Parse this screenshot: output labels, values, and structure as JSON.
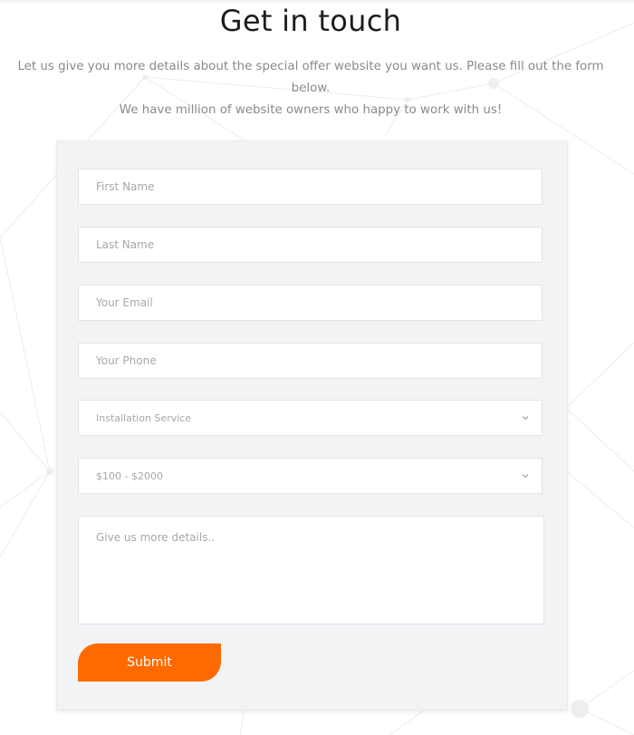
{
  "header": {
    "title": "Get in touch",
    "subtitle_line1": "Let us give you more details about the special offer website you want us. Please fill out the form below.",
    "subtitle_line2": "We have million of website owners who happy to work with us!"
  },
  "form": {
    "first_name_placeholder": "First Name",
    "last_name_placeholder": "Last Name",
    "email_placeholder": "Your Email",
    "phone_placeholder": "Your Phone",
    "service_selected": "Installation Service",
    "budget_selected": "$100 - $2000",
    "details_placeholder": "Give us more details..",
    "submit_label": "Submit"
  },
  "colors": {
    "accent": "#ff6a00",
    "card_bg": "#f2f3f5"
  },
  "icons": {
    "select_arrow": "chevron-down-icon"
  }
}
